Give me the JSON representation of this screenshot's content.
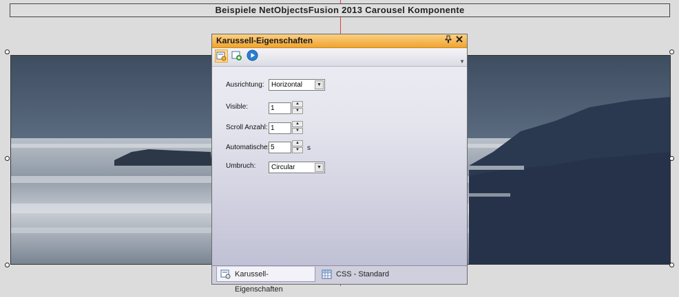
{
  "page": {
    "heading": "Beispiele NetObjectsFusion 2013 Carousel Komponente"
  },
  "panel": {
    "title": "Karussell-Eigenschaften",
    "pin_icon": "pin-icon",
    "close_icon": "close-icon",
    "toolbar": {
      "buttons": [
        {
          "name": "carousel-properties-icon",
          "active": true
        },
        {
          "name": "add-slide-icon",
          "active": false
        },
        {
          "name": "play-icon",
          "active": false
        }
      ]
    },
    "fields": {
      "ausrichtung": {
        "label": "Ausrichtung:",
        "value": "Horizontal"
      },
      "visible": {
        "label": "Visible:",
        "value": "1"
      },
      "scroll": {
        "label": "Scroll Anzahl:",
        "value": "1"
      },
      "automatische": {
        "label": "Automatische:",
        "value": "5",
        "unit": "s"
      },
      "umbruch": {
        "label": "Umbruch:",
        "value": "Circular"
      }
    },
    "tabs": [
      {
        "label": "Karussell-Eigenschaften",
        "icon": "carousel-properties-icon",
        "active": true
      },
      {
        "label": "CSS - Standard",
        "icon": "css-grid-icon",
        "active": false
      }
    ]
  },
  "colors": {
    "header_orange": "#f0a330",
    "guide_line": "#e23b3b",
    "play_blue": "#2a7fd0"
  }
}
